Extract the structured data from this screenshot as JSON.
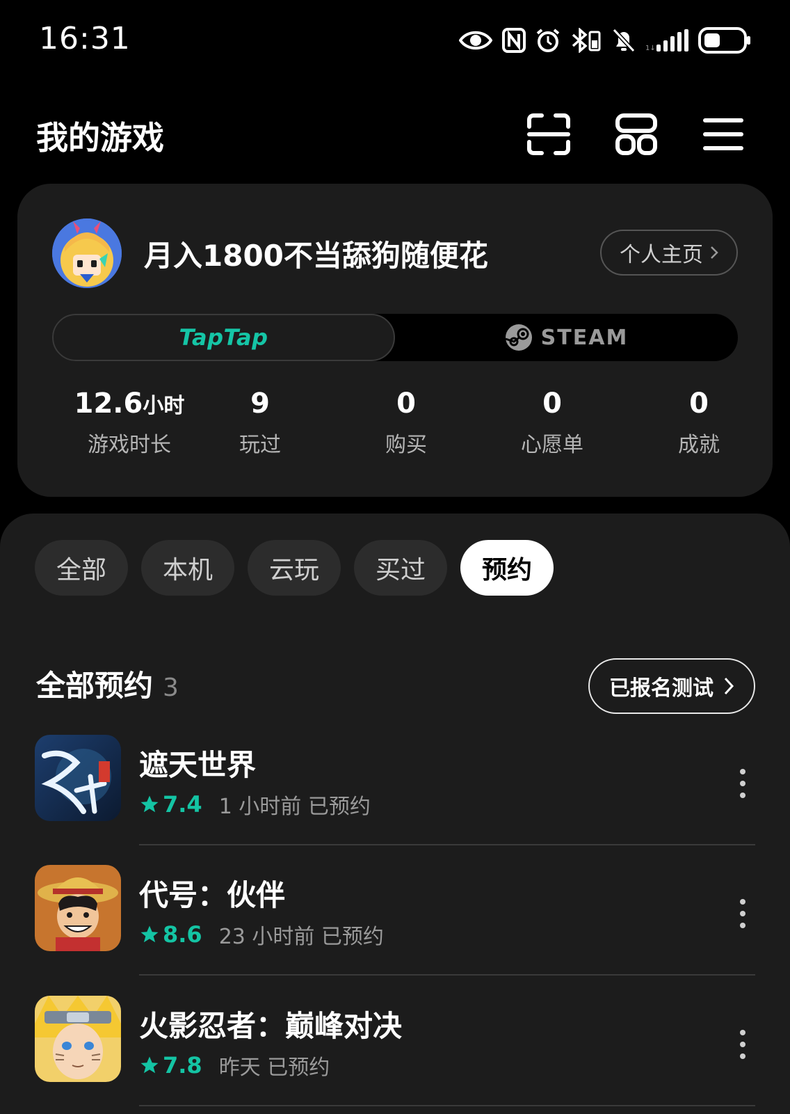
{
  "status_bar": {
    "time": "16:31"
  },
  "header": {
    "title": "我的游戏",
    "icons": [
      "scan-icon",
      "layout-grid-icon",
      "menu-icon"
    ]
  },
  "profile": {
    "username": "月入1800不当舔狗随便花",
    "profile_link": "个人主页",
    "platforms": {
      "taptap": "TapTap",
      "steam": "STEAM",
      "active": "taptap"
    },
    "stats": [
      {
        "value": "12.6",
        "unit": "小时",
        "label": "游戏时长"
      },
      {
        "value": "9",
        "unit": "",
        "label": "玩过"
      },
      {
        "value": "0",
        "unit": "",
        "label": "购买"
      },
      {
        "value": "0",
        "unit": "",
        "label": "心愿单"
      },
      {
        "value": "0",
        "unit": "",
        "label": "成就"
      }
    ]
  },
  "filters": {
    "chips": [
      "全部",
      "本机",
      "云玩",
      "买过",
      "预约"
    ],
    "active": "预约"
  },
  "section": {
    "title": "全部预约",
    "count": "3",
    "signup_label": "已报名测试"
  },
  "games": [
    {
      "name": "遮天世界",
      "rating": "7.4",
      "reserve_info": "1 小时前 已预约"
    },
    {
      "name": "代号：伙伴",
      "rating": "8.6",
      "reserve_info": "23 小时前 已预约"
    },
    {
      "name": "火影忍者：巅峰对决",
      "rating": "7.8",
      "reserve_info": "昨天 已预约"
    }
  ],
  "colors": {
    "accent": "#14c4a4",
    "background": "#000000",
    "card": "#1c1c1c",
    "chip": "#2c2c2c"
  }
}
